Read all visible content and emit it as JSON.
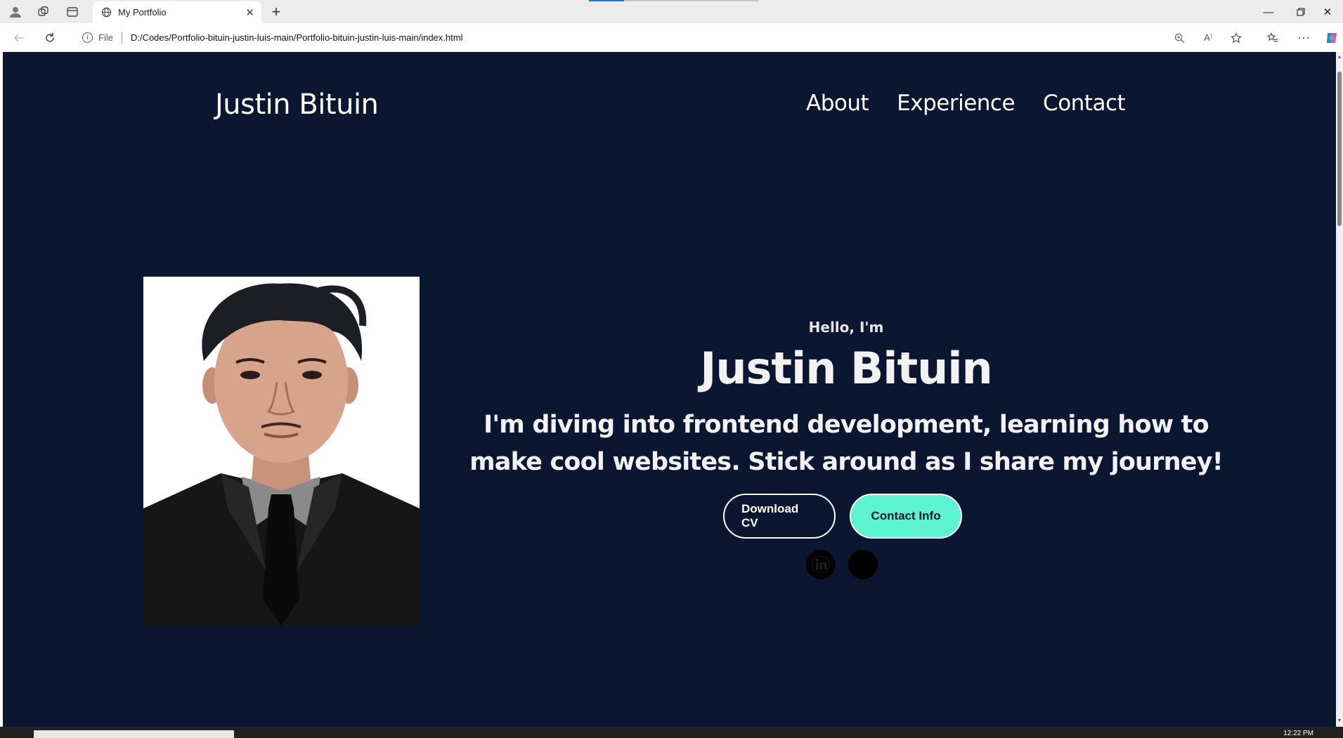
{
  "browser": {
    "tab_title": "My Portfolio",
    "address_prefix": "File",
    "url": "D:/Codes/Portfolio-bituin-justin-luis-main/Portfolio-bituin-justin-luis-main/index.html",
    "clock": "12:22 PM"
  },
  "site": {
    "logo": "Justin Bituin",
    "nav": [
      "About",
      "Experience",
      "Contact"
    ]
  },
  "hero": {
    "greeting": "Hello, I'm",
    "name": "Justin Bituin",
    "tagline": "I'm diving into frontend development, learning how to make cool websites. Stick around as I share my journey!",
    "buttons": {
      "download_cv": "Download CV",
      "contact_info": "Contact Info"
    },
    "socials": [
      "linkedin-icon",
      "github-icon"
    ]
  },
  "colors": {
    "page_bg": "#0b1730",
    "accent": "#5cf2d2",
    "text": "#ffffff"
  }
}
